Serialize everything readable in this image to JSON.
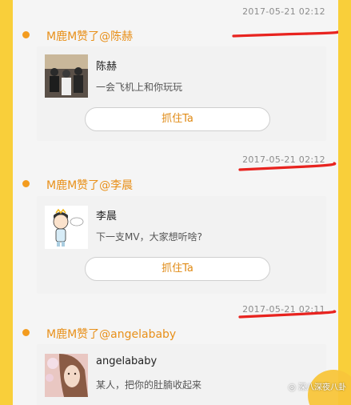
{
  "feed": [
    {
      "timestamp": "2017-05-21 02:12",
      "action": "M鹿M赞了@陈赫",
      "card": {
        "name": "陈赫",
        "text": "一会飞机上和你玩玩",
        "button": "抓住Ta"
      }
    },
    {
      "timestamp": "2017-05-21 02:12",
      "action": "M鹿M赞了@李晨",
      "card": {
        "name": "李晨",
        "text": "下一支MV，大家想听啥?",
        "button": "抓住Ta"
      }
    },
    {
      "timestamp": "2017-05-21 02:11",
      "action": "M鹿M赞了@angelababy",
      "card": {
        "name": "angelababy",
        "text": "某人，把你的肚腩收起来",
        "button": ""
      }
    }
  ],
  "watermark": "深八深夜八卦",
  "colors": {
    "accent": "#f39c1f",
    "frame": "#f9cf3a",
    "underline": "#e8231f"
  }
}
